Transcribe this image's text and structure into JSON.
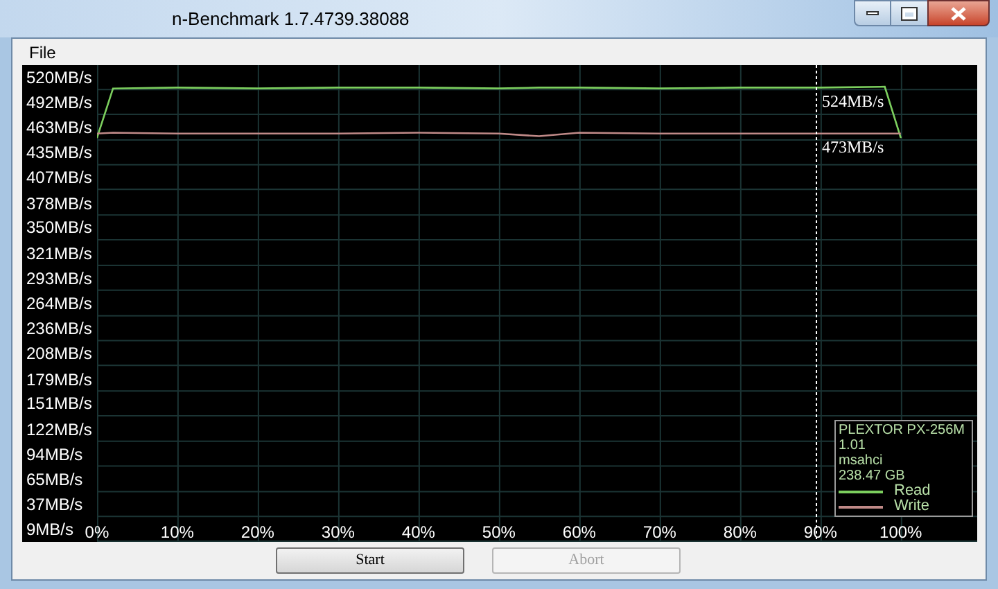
{
  "window": {
    "title": "n-Benchmark 1.7.4739.38088"
  },
  "menu": [
    {
      "label": "File"
    }
  ],
  "chart": {
    "chart_data": {
      "type": "line",
      "x": [
        0,
        2,
        10,
        20,
        30,
        40,
        50,
        55,
        60,
        70,
        80,
        90,
        98,
        100
      ],
      "series": [
        {
          "name": "Read",
          "color": "#7ccf5e",
          "values": [
            466,
            522,
            523,
            522,
            523,
            523,
            522,
            523,
            523,
            522,
            523,
            523,
            524,
            466
          ]
        },
        {
          "name": "Write",
          "color": "#c08a88",
          "values": [
            471,
            472,
            471,
            471,
            471,
            472,
            471,
            468,
            472,
            471,
            471,
            471,
            471,
            471
          ]
        }
      ],
      "xlim": [
        -9.3,
        109.5
      ],
      "ylim": [
        9,
        548.4
      ],
      "grid": true,
      "legend": true,
      "ref_lines": [
        {
          "axis": "x",
          "value": 89.5,
          "color": "#ffffff"
        }
      ],
      "xticks": [
        {
          "value": 0,
          "label": "0%"
        },
        {
          "value": 10,
          "label": "10%"
        },
        {
          "value": 20,
          "label": "20%"
        },
        {
          "value": 30,
          "label": "30%"
        },
        {
          "value": 40,
          "label": "40%"
        },
        {
          "value": 50,
          "label": "50%"
        },
        {
          "value": 60,
          "label": "60%"
        },
        {
          "value": 70,
          "label": "70%"
        },
        {
          "value": 80,
          "label": "80%"
        },
        {
          "value": 90,
          "label": "90%"
        },
        {
          "value": 100,
          "label": "100%"
        }
      ],
      "yticks": [
        {
          "value": 520,
          "label": "520MB/s"
        },
        {
          "value": 492,
          "label": "492MB/s"
        },
        {
          "value": 463,
          "label": "463MB/s"
        },
        {
          "value": 435,
          "label": "435MB/s"
        },
        {
          "value": 407,
          "label": "407MB/s"
        },
        {
          "value": 378,
          "label": "378MB/s"
        },
        {
          "value": 350,
          "label": "350MB/s"
        },
        {
          "value": 321,
          "label": "321MB/s"
        },
        {
          "value": 293,
          "label": "293MB/s"
        },
        {
          "value": 264,
          "label": "264MB/s"
        },
        {
          "value": 236,
          "label": "236MB/s"
        },
        {
          "value": 208,
          "label": "208MB/s"
        },
        {
          "value": 179,
          "label": "179MB/s"
        },
        {
          "value": 151,
          "label": "151MB/s"
        },
        {
          "value": 122,
          "label": "122MB/s"
        },
        {
          "value": 94,
          "label": "94MB/s"
        },
        {
          "value": 65,
          "label": "65MB/s"
        },
        {
          "value": 37,
          "label": "37MB/s"
        },
        {
          "value": 9,
          "label": "9MB/s"
        }
      ]
    },
    "readings": [
      "524MB/s",
      "473MB/s"
    ],
    "legend": {
      "lines": [
        "PLEXTOR PX-256M",
        "1.01",
        "msahci",
        "238.47 GB"
      ]
    }
  },
  "buttons": [
    {
      "label": "Start",
      "disabled": false
    },
    {
      "label": "Abort",
      "disabled": true
    }
  ]
}
